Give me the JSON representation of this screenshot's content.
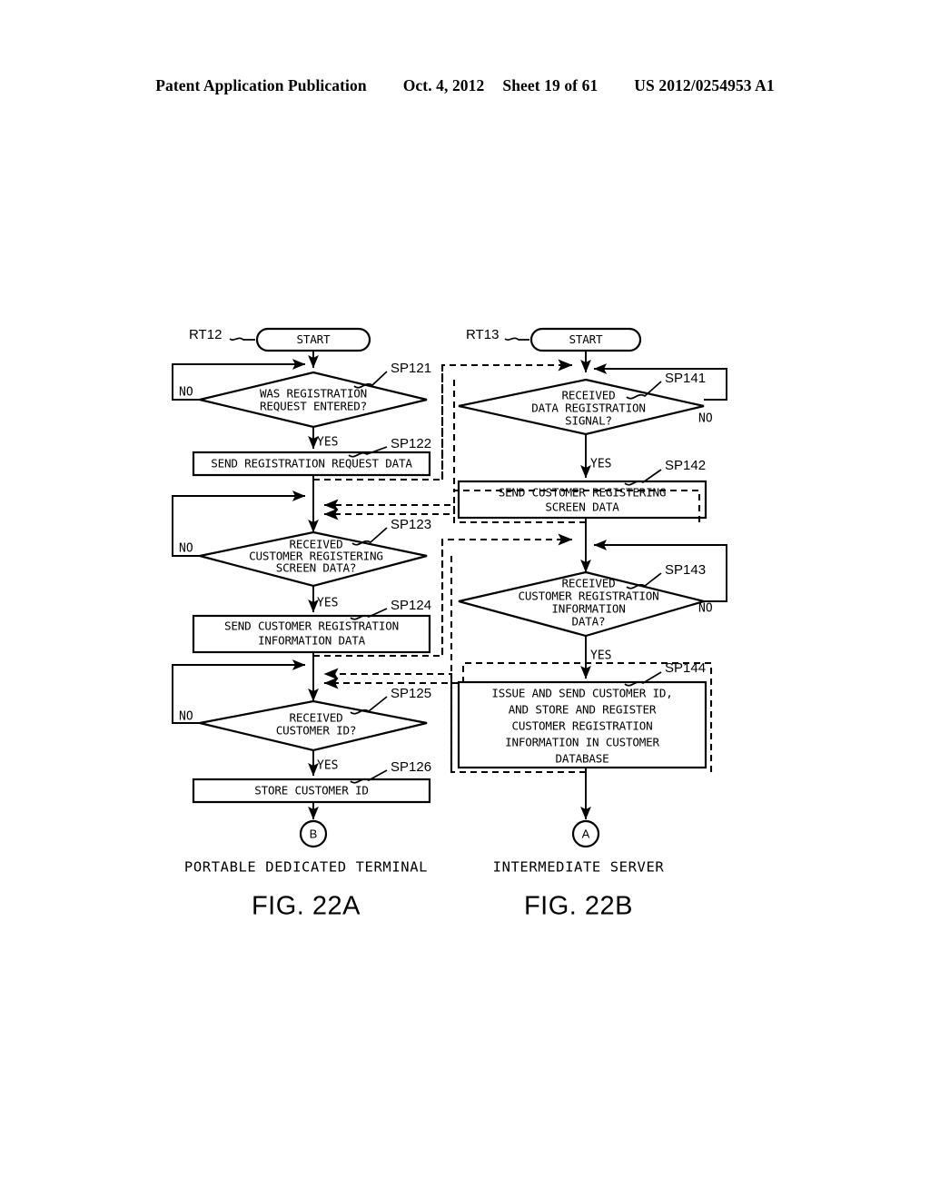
{
  "header": {
    "publication": "Patent Application Publication",
    "date": "Oct. 4, 2012",
    "sheet": "Sheet 19 of 61",
    "patent_number": "US 2012/0254953 A1"
  },
  "figures": [
    {
      "caption": "FIG. 22A",
      "subtitle": "PORTABLE DEDICATED TERMINAL",
      "routine_id": "RT12",
      "start_label": "START",
      "end_connector": "B"
    },
    {
      "caption": "FIG. 22B",
      "subtitle": "INTERMEDIATE SERVER",
      "routine_id": "RT13",
      "start_label": "START",
      "end_connector": "A"
    }
  ],
  "left_flow": {
    "steps": [
      {
        "id": "SP121",
        "type": "decision",
        "lines": [
          "WAS REGISTRATION",
          "REQUEST ENTERED?"
        ],
        "no_label": "NO",
        "yes_label": "YES"
      },
      {
        "id": "SP122",
        "type": "process",
        "lines": [
          "SEND REGISTRATION REQUEST DATA"
        ]
      },
      {
        "id": "SP123",
        "type": "decision",
        "lines": [
          "RECEIVED",
          "CUSTOMER REGISTERING",
          "SCREEN DATA?"
        ],
        "no_label": "NO",
        "yes_label": "YES"
      },
      {
        "id": "SP124",
        "type": "process",
        "lines": [
          "SEND CUSTOMER REGISTRATION",
          "INFORMATION DATA"
        ]
      },
      {
        "id": "SP125",
        "type": "decision",
        "lines": [
          "RECEIVED",
          "CUSTOMER ID?"
        ],
        "no_label": "NO",
        "yes_label": "YES"
      },
      {
        "id": "SP126",
        "type": "process",
        "lines": [
          "STORE CUSTOMER ID"
        ]
      }
    ]
  },
  "right_flow": {
    "steps": [
      {
        "id": "SP141",
        "type": "decision",
        "lines": [
          "RECEIVED",
          "DATA REGISTRATION",
          "SIGNAL?"
        ],
        "no_label": "NO",
        "yes_label": "YES"
      },
      {
        "id": "SP142",
        "type": "process",
        "lines": [
          "SEND CUSTOMER REGISTERING",
          "SCREEN DATA"
        ]
      },
      {
        "id": "SP143",
        "type": "decision",
        "lines": [
          "RECEIVED",
          "CUSTOMER REGISTRATION",
          "INFORMATION",
          "DATA?"
        ],
        "no_label": "NO",
        "yes_label": "YES"
      },
      {
        "id": "SP144",
        "type": "process",
        "lines": [
          "ISSUE AND SEND CUSTOMER ID,",
          "AND STORE AND REGISTER",
          "CUSTOMER REGISTRATION",
          "INFORMATION IN CUSTOMER",
          "DATABASE"
        ]
      }
    ]
  },
  "colors": {
    "ink": "#000000",
    "paper": "#ffffff"
  }
}
